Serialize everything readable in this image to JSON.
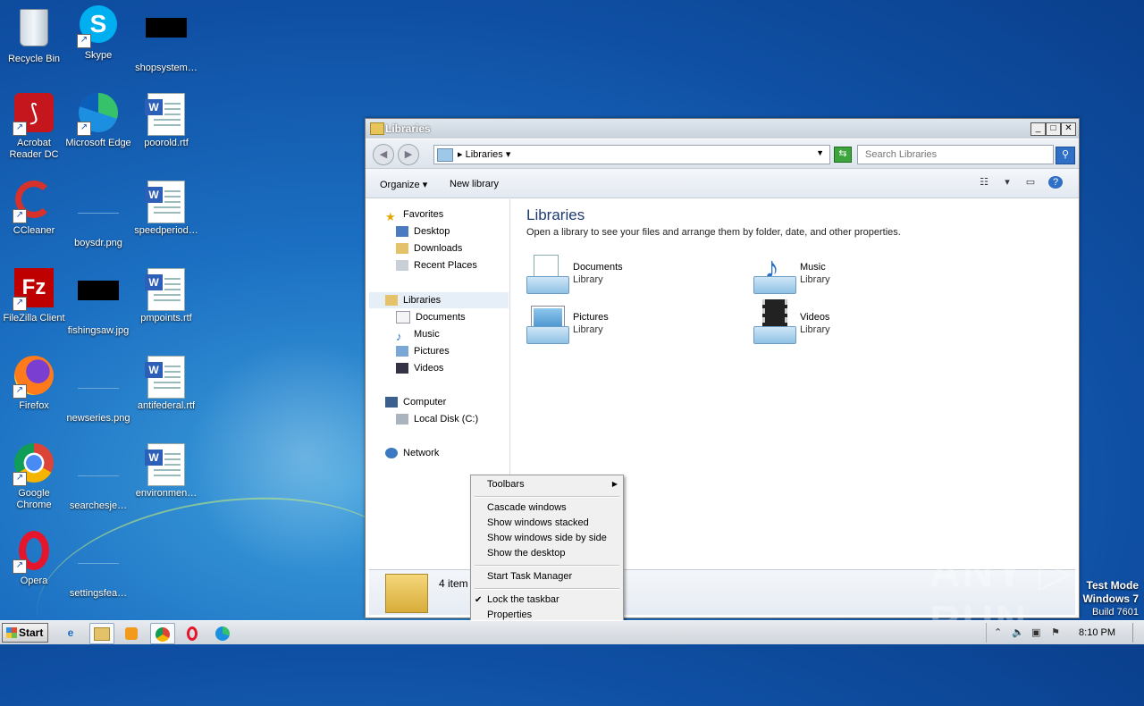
{
  "desktop": {
    "icons": [
      {
        "label": "Recycle Bin",
        "icon": "recycle-bin-icon"
      },
      {
        "label": "Skype",
        "icon": "skype-icon"
      },
      {
        "label": "shopsystem…",
        "icon": "image-thumbnail-icon"
      },
      {
        "label": "Acrobat Reader DC",
        "icon": "acrobat-icon"
      },
      {
        "label": "Microsoft Edge",
        "icon": "edge-icon"
      },
      {
        "label": "poorold.rtf",
        "icon": "word-doc-icon"
      },
      {
        "label": "CCleaner",
        "icon": "ccleaner-icon"
      },
      {
        "label": "boysdr.png",
        "icon": "image-thumbnail-icon"
      },
      {
        "label": "speedperiod…",
        "icon": "word-doc-icon"
      },
      {
        "label": "FileZilla Client",
        "icon": "filezilla-icon"
      },
      {
        "label": "fishingsaw.jpg",
        "icon": "image-thumbnail-icon"
      },
      {
        "label": "pmpoints.rtf",
        "icon": "word-doc-icon"
      },
      {
        "label": "Firefox",
        "icon": "firefox-icon"
      },
      {
        "label": "newseries.png",
        "icon": "image-thumbnail-icon"
      },
      {
        "label": "antifederal.rtf",
        "icon": "word-doc-icon"
      },
      {
        "label": "Google Chrome",
        "icon": "chrome-icon"
      },
      {
        "label": "searchesje…",
        "icon": "image-thumbnail-icon"
      },
      {
        "label": "environmen…",
        "icon": "word-doc-icon"
      },
      {
        "label": "Opera",
        "icon": "opera-icon"
      },
      {
        "label": "settingsfea…",
        "icon": "image-thumbnail-icon"
      }
    ]
  },
  "window": {
    "title": "Libraries",
    "address": {
      "crumb": "Libraries"
    },
    "search": {
      "placeholder": "Search Libraries"
    },
    "toolbar": {
      "organize": "Organize",
      "new_library": "New library"
    },
    "nav": {
      "favorites": "Favorites",
      "desktop": "Desktop",
      "downloads": "Downloads",
      "recent": "Recent Places",
      "libraries": "Libraries",
      "documents": "Documents",
      "music": "Music",
      "pictures": "Pictures",
      "videos": "Videos",
      "computer": "Computer",
      "local_disk": "Local Disk (C:)",
      "network": "Network"
    },
    "content": {
      "heading": "Libraries",
      "subtitle": "Open a library to see your files and arrange them by folder, date, and other properties.",
      "libraries": [
        {
          "name": "Documents",
          "kind": "Library"
        },
        {
          "name": "Music",
          "kind": "Library"
        },
        {
          "name": "Pictures",
          "kind": "Library"
        },
        {
          "name": "Videos",
          "kind": "Library"
        }
      ]
    },
    "details": {
      "count": "4 item"
    }
  },
  "context_menu": {
    "toolbars": "Toolbars",
    "cascade": "Cascade windows",
    "stacked": "Show windows stacked",
    "side_by_side": "Show windows side by side",
    "show_desktop": "Show the desktop",
    "task_manager": "Start Task Manager",
    "lock_taskbar": "Lock the taskbar",
    "properties": "Properties"
  },
  "watermark": {
    "text": "ANY ▷ RUN",
    "mode": "Test Mode",
    "os": "Windows 7",
    "build": "Build 7601"
  },
  "taskbar": {
    "start": "Start",
    "clock": "8:10 PM"
  },
  "colors": {
    "desktop_blue": "#1b6fc2",
    "selection": "#e6eef8",
    "heading": "#1e3a70"
  }
}
